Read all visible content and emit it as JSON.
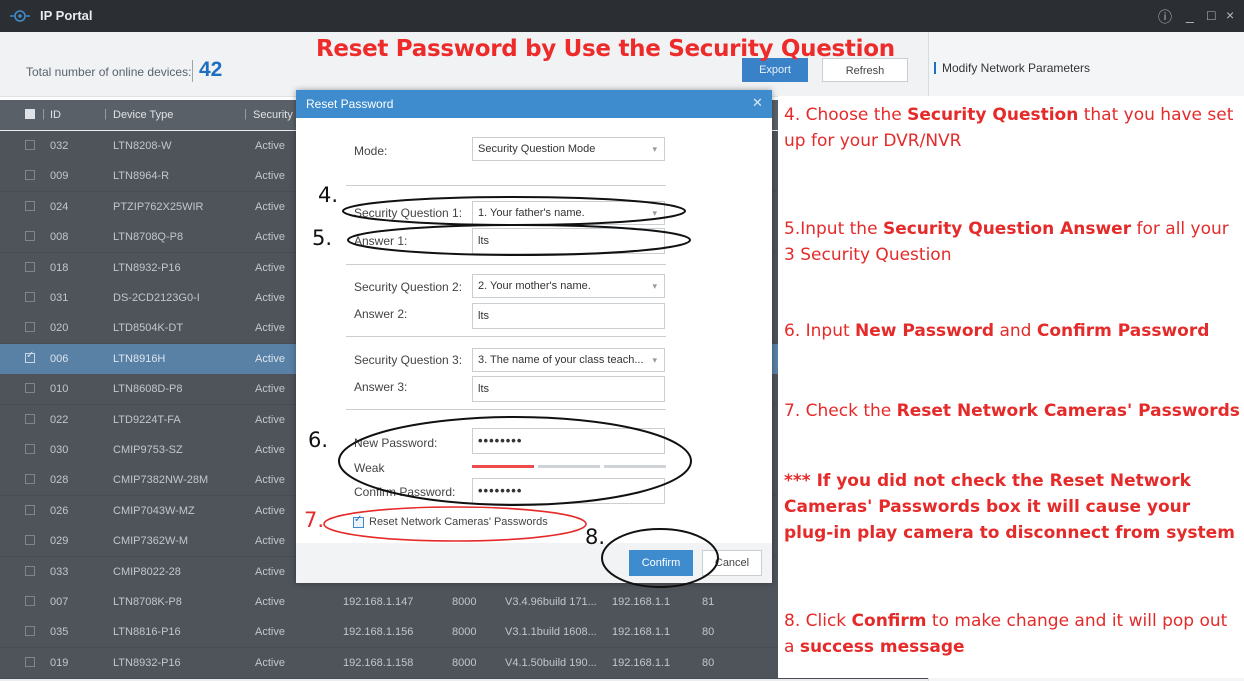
{
  "app": {
    "title": "IP Portal",
    "window_controls": [
      "ⓘ",
      "_",
      "□",
      "×"
    ]
  },
  "header": {
    "device_count_label": "Total number of online devices:",
    "device_count": "42",
    "export_label": "Export",
    "refresh_label": "Refresh"
  },
  "banner": "Reset Password by Use the Security Question",
  "right_panel": {
    "title": "Modify Network Parameters"
  },
  "table": {
    "columns": [
      "ID",
      "Device Type",
      "Security"
    ],
    "rows": [
      {
        "id": "032",
        "type": "LTN8208-W",
        "security": "Active"
      },
      {
        "id": "009",
        "type": "LTN8964-R",
        "security": "Active"
      },
      {
        "id": "024",
        "type": "PTZIP762X25WIR",
        "security": "Active"
      },
      {
        "id": "008",
        "type": "LTN8708Q-P8",
        "security": "Active"
      },
      {
        "id": "018",
        "type": "LTN8932-P16",
        "security": "Active"
      },
      {
        "id": "031",
        "type": "DS-2CD2123G0-I",
        "security": "Active"
      },
      {
        "id": "020",
        "type": "LTD8504K-DT",
        "security": "Active"
      },
      {
        "id": "006",
        "type": "LTN8916H",
        "security": "Active",
        "selected": true
      },
      {
        "id": "010",
        "type": "LTN8608D-P8",
        "security": "Active"
      },
      {
        "id": "022",
        "type": "LTD9224T-FA",
        "security": "Active"
      },
      {
        "id": "030",
        "type": "CMIP9753-SZ",
        "security": "Active"
      },
      {
        "id": "028",
        "type": "CMIP7382NW-28M",
        "security": "Active"
      },
      {
        "id": "026",
        "type": "CMIP7043W-MZ",
        "security": "Active"
      },
      {
        "id": "029",
        "type": "CMIP7362W-M",
        "security": "Active"
      },
      {
        "id": "033",
        "type": "CMIP8022-28",
        "security": "Active"
      },
      {
        "id": "007",
        "type": "LTN8708K-P8",
        "security": "Active",
        "ip": "192.168.1.147",
        "port": "8000",
        "version": "V3.4.96build 171...",
        "gateway": "192.168.1.1",
        "http": "81"
      },
      {
        "id": "035",
        "type": "LTN8816-P16",
        "security": "Active",
        "ip": "192.168.1.156",
        "port": "8000",
        "version": "V3.1.1build 1608...",
        "gateway": "192.168.1.1",
        "http": "80"
      },
      {
        "id": "019",
        "type": "LTN8932-P16",
        "security": "Active",
        "ip": "192.168.1.158",
        "port": "8000",
        "version": "V4.1.50build 190...",
        "gateway": "192.168.1.1",
        "http": "80"
      }
    ]
  },
  "dialog": {
    "title": "Reset Password",
    "mode_label": "Mode:",
    "mode_value": "Security Question Mode",
    "q1_label": "Security Question 1:",
    "q1_value": "1. Your father's name.",
    "a1_label": "Answer 1:",
    "a1_value": "lts",
    "q2_label": "Security Question 2:",
    "q2_value": "2. Your mother's name.",
    "a2_label": "Answer 2:",
    "a2_value": "lts",
    "q3_label": "Security Question 3:",
    "q3_value": "3. The name of your class teach...",
    "a3_label": "Answer 3:",
    "a3_value": "lts",
    "new_pw_label": "New Password:",
    "new_pw_value": "••••••••",
    "strength_label": "Weak",
    "strength": 0.33,
    "confirm_pw_label": "Confirm Password:",
    "confirm_pw_value": "••••••••",
    "reset_cameras_label": "Reset Network Cameras' Passwords",
    "reset_cameras_checked": true,
    "confirm_label": "Confirm",
    "cancel_label": "Cancel"
  },
  "steps": {
    "n4": "4.",
    "n5": "5.",
    "n6": "6.",
    "n7": "7.",
    "n8": "8.",
    "s4_a": "4. Choose the ",
    "s4_b": "Security Question",
    "s4_c": " that you have set up for your DVR/NVR",
    "s5_a": "5.Input the ",
    "s5_b": "Security Question Answer",
    "s5_c": " for all your 3 Security Question",
    "s6_a": "6. Input ",
    "s6_b": "New Password",
    "s6_c": " and ",
    "s6_d": "Confirm Password",
    "s7_a": "7. Check the ",
    "s7_b": "Reset Network Cameras' Passwords",
    "warning": "*** If you did not check the Reset Network Cameras' Passwords box it will cause your plug-in play camera to disconnect from system",
    "s8_a": "8. Click ",
    "s8_b": "Confirm",
    "s8_c": " to make change and it will pop out a ",
    "s8_d": "success message"
  },
  "colors": {
    "accent": "#3e8ccd",
    "annotation": "#e52a2a",
    "titlebar": "#2b2f33"
  }
}
